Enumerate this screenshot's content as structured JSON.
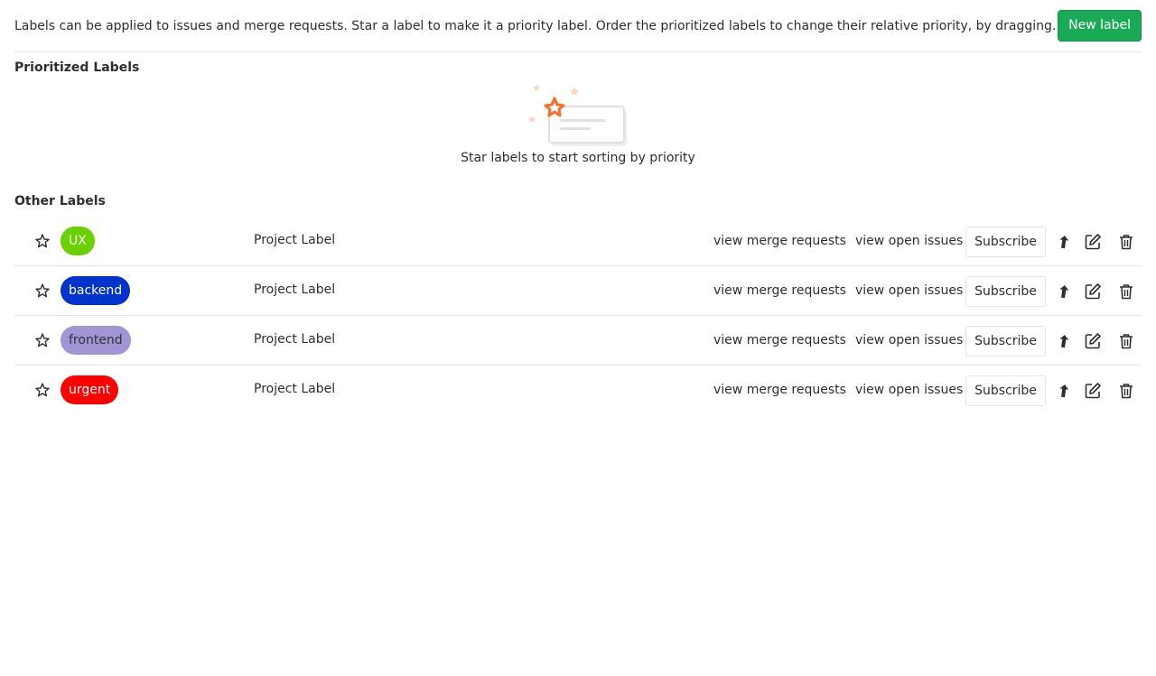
{
  "header": {
    "intro_text": "Labels can be applied to issues and merge requests. Star a label to make it a priority label. Order the prioritized labels to change their relative priority, by dragging.",
    "new_label_button": "New label"
  },
  "prioritized": {
    "title": "Prioritized Labels",
    "empty_text": "Star labels to start sorting by priority"
  },
  "other": {
    "title": "Other Labels",
    "labels": [
      {
        "name": "UX",
        "description": "Project Label",
        "bg_color": "#69d100",
        "text_color": "#ffffff",
        "view_mr": "view merge requests",
        "view_issues": "view open issues",
        "subscribe": "Subscribe"
      },
      {
        "name": "backend",
        "description": "Project Label",
        "bg_color": "#0033cc",
        "text_color": "#ffffff",
        "view_mr": "view merge requests",
        "view_issues": "view open issues",
        "subscribe": "Subscribe"
      },
      {
        "name": "frontend",
        "description": "Project Label",
        "bg_color": "#a295d6",
        "text_color": "#333333",
        "view_mr": "view merge requests",
        "view_issues": "view open issues",
        "subscribe": "Subscribe"
      },
      {
        "name": "urgent",
        "description": "Project Label",
        "bg_color": "#ff0000",
        "text_color": "#ffffff",
        "view_mr": "view merge requests",
        "view_issues": "view open issues",
        "subscribe": "Subscribe"
      }
    ]
  },
  "icons": {
    "star": "star-outline-icon",
    "promote": "promote-arrow-icon",
    "edit": "edit-pencil-icon",
    "delete": "trash-icon"
  },
  "colors": {
    "primary_green": "#1aaa55",
    "accent_orange": "#fc6d26",
    "border": "#e5e5e5"
  }
}
